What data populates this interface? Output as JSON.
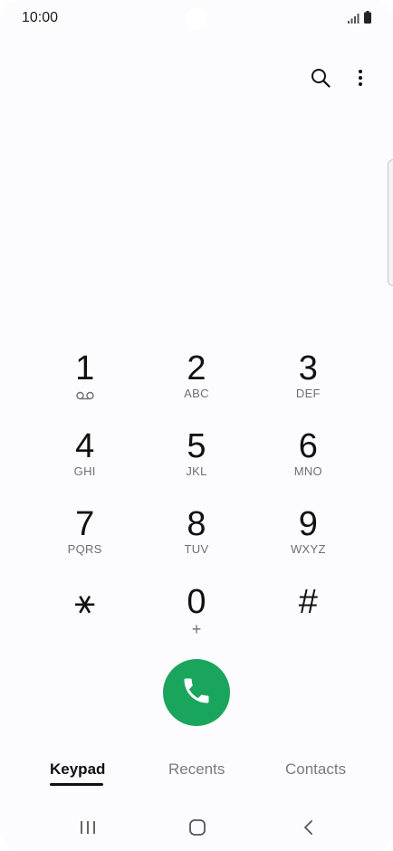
{
  "status_bar": {
    "time": "10:00"
  },
  "header": {
    "search_icon": "search-icon",
    "more_icon": "more-vert-icon"
  },
  "keypad": {
    "keys": [
      {
        "digit": "1",
        "letters": "",
        "sub_icon": "voicemail-icon"
      },
      {
        "digit": "2",
        "letters": "ABC"
      },
      {
        "digit": "3",
        "letters": "DEF"
      },
      {
        "digit": "4",
        "letters": "GHI"
      },
      {
        "digit": "5",
        "letters": "JKL"
      },
      {
        "digit": "6",
        "letters": "MNO"
      },
      {
        "digit": "7",
        "letters": "PQRS"
      },
      {
        "digit": "8",
        "letters": "TUV"
      },
      {
        "digit": "9",
        "letters": "WXYZ"
      },
      {
        "digit": "⚹",
        "letters": ""
      },
      {
        "digit": "0",
        "letters": "+"
      },
      {
        "digit": "#",
        "letters": ""
      }
    ]
  },
  "call_button": {
    "icon": "phone-icon",
    "color": "#1aa55c"
  },
  "tabs": [
    {
      "label": "Keypad",
      "active": true
    },
    {
      "label": "Recents",
      "active": false
    },
    {
      "label": "Contacts",
      "active": false
    }
  ],
  "nav_bar": {
    "recents_icon": "recent-apps-icon",
    "home_icon": "home-icon",
    "back_icon": "back-icon"
  }
}
